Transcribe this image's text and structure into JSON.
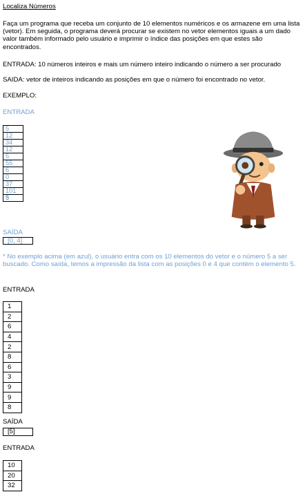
{
  "title": "Localiza Números",
  "intro": "Faça um programa que receba um conjunto de 10 elementos numéricos e os armazene em uma lista (vetor). Em seguida, o programa deverá procurar se existem no vetor elementos iguais a um dado valor também informado pelo usuário e imprimir o índice das posições em que estes são encontrados.",
  "entrada_desc": "ENTRADA: 10 números inteiros e mais um número inteiro indicando o número a ser procurado",
  "saida_desc": "SAIDA: vetor de inteiros indicando as posições em que o número foi encontrado no vetor.",
  "exemplo_label": "EXEMPLO:",
  "example1": {
    "entrada_label": "ENTRADA",
    "values": [
      "5",
      "12",
      "34",
      "12",
      "5",
      "55",
      "6",
      "0",
      "37",
      "101",
      "5"
    ],
    "saida_label": "SAÍDA",
    "output": "[0, 4]",
    "note": "* No exemplo acima (em azul), o usuário entra com os 10 elementos do vetor e o número 5 a ser buscado. Como saída, temos a impressão da lista com as posições 0 e 4 que contém o elemento 5."
  },
  "example2": {
    "entrada_label": "ENTRADA",
    "values": [
      "1",
      "2",
      "6",
      "4",
      "2",
      "8",
      "6",
      "3",
      "9",
      "9",
      "8"
    ],
    "saida_label": "SAÍDA",
    "output": "[5]"
  },
  "example3": {
    "entrada_label": "ENTRADA",
    "values": [
      "10",
      "20",
      "32"
    ]
  },
  "colors": {
    "accent_blue": "#6f9fd2",
    "text": "#000000"
  },
  "illustration": "detective-with-magnifying-glass"
}
